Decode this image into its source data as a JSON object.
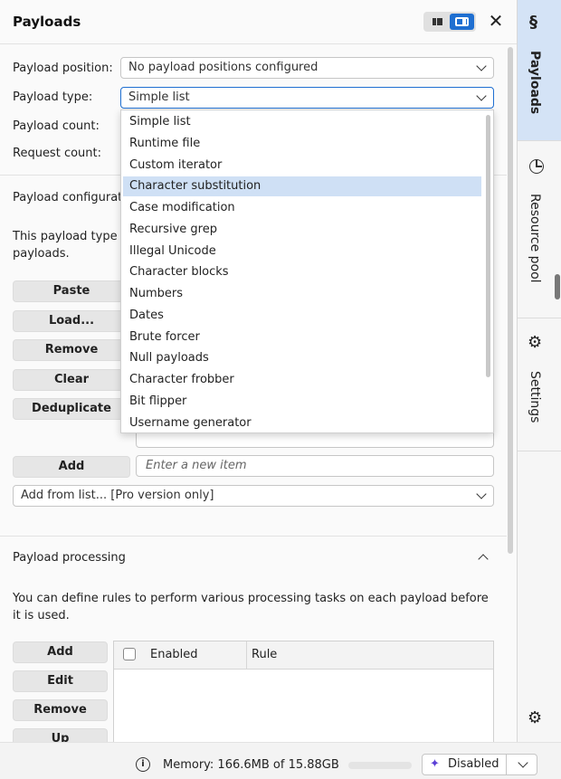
{
  "panel": {
    "title": "Payloads"
  },
  "positions": {
    "position_label": "Payload position:",
    "position_value": "No payload positions configured",
    "type_label": "Payload type:",
    "type_value": "Simple list",
    "count_label": "Payload count:",
    "request_label": "Request count:"
  },
  "dropdown": {
    "options": [
      "Simple list",
      "Runtime file",
      "Custom iterator",
      "Character substitution",
      "Case modification",
      "Recursive grep",
      "Illegal Unicode",
      "Character blocks",
      "Numbers",
      "Dates",
      "Brute forcer",
      "Null payloads",
      "Character frobber",
      "Bit flipper",
      "Username generator"
    ],
    "selected": "Character substitution"
  },
  "config": {
    "heading": "Payload configurati",
    "description_line1": "This payload type l",
    "description_line2": "payloads.",
    "buttons": [
      "Paste",
      "Load...",
      "Remove",
      "Clear",
      "Deduplicate"
    ],
    "add_label": "Add",
    "new_item_placeholder": "Enter a new item",
    "add_from_list": "Add from list... [Pro version only]"
  },
  "processing": {
    "heading": "Payload processing",
    "description": "You can define rules to perform various processing tasks on each payload before it is used.",
    "buttons": [
      "Add",
      "Edit",
      "Remove",
      "Up"
    ],
    "columns": [
      "Enabled",
      "Rule"
    ]
  },
  "sidebar": {
    "tabs": [
      "Payloads",
      "Resource pool",
      "Settings"
    ]
  },
  "statusbar": {
    "memory": "Memory: 166.6MB of 15.88GB",
    "ai_state": "Disabled"
  }
}
